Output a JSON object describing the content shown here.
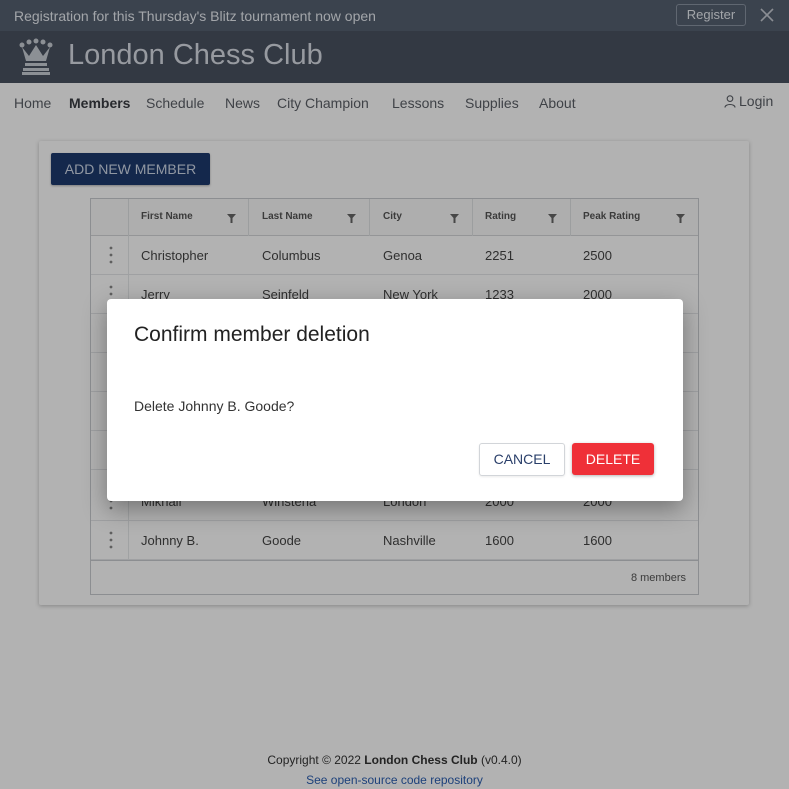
{
  "banner": {
    "text": "Registration for this Thursday's Blitz tournament now open",
    "register_label": "Register"
  },
  "header": {
    "title": "London Chess Club"
  },
  "nav": {
    "items": [
      {
        "label": "Home"
      },
      {
        "label": "Members"
      },
      {
        "label": "Schedule"
      },
      {
        "label": "News"
      },
      {
        "label": "City Champion"
      },
      {
        "label": "Lessons"
      },
      {
        "label": "Supplies"
      },
      {
        "label": "About"
      }
    ],
    "login_label": "Login"
  },
  "members": {
    "add_button_label": "ADD NEW MEMBER",
    "columns": [
      "First Name",
      "Last Name",
      "City",
      "Rating",
      "Peak Rating"
    ],
    "rows": [
      [
        "Christopher",
        "Columbus",
        "Genoa",
        "2251",
        "2500"
      ],
      [
        "Jerry",
        "Seinfeld",
        "New York",
        "1233",
        "2000"
      ],
      [
        "",
        "",
        "",
        "",
        ""
      ],
      [
        "",
        "",
        "",
        "",
        ""
      ],
      [
        "",
        "",
        "",
        "",
        ""
      ],
      [
        "",
        "",
        "",
        "",
        ""
      ],
      [
        "Mikhail",
        "Winstena",
        "London",
        "2000",
        "2000"
      ],
      [
        "Johnny B.",
        "Goode",
        "Nashville",
        "1600",
        "1600"
      ]
    ],
    "count_label": "8 members"
  },
  "footer": {
    "copyright_prefix": "Copyright © 2022 ",
    "club_name": "London Chess Club",
    "version": " (v0.4.0)",
    "repo_link": "See open-source code repository"
  },
  "dialog": {
    "title": "Confirm member deletion",
    "message": "Delete Johnny B. Goode?",
    "cancel_label": "CANCEL",
    "delete_label": "DELETE"
  }
}
